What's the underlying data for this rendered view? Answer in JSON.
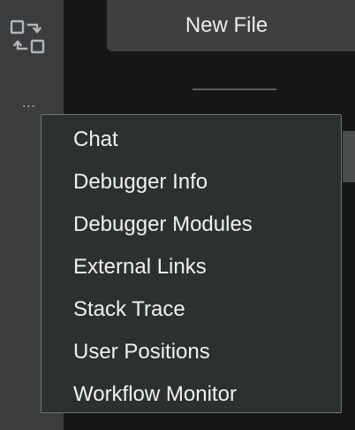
{
  "activity_bar": {
    "icons": [
      {
        "name": "swap-view-icon"
      },
      {
        "name": "more-options-icon",
        "glyph": "⋯"
      }
    ]
  },
  "editor": {
    "new_file_label": "New File"
  },
  "menu": {
    "items": [
      {
        "label": "Chat"
      },
      {
        "label": "Debugger Info"
      },
      {
        "label": "Debugger Modules"
      },
      {
        "label": "External Links"
      },
      {
        "label": "Stack Trace"
      },
      {
        "label": "User Positions"
      },
      {
        "label": "Workflow Monitor"
      }
    ]
  },
  "colors": {
    "activity_bar_bg": "#3a3c3d",
    "main_bg": "#171717",
    "button_bg": "#3d3f40",
    "menu_bg": "#2d3031",
    "menu_border": "#707273",
    "text": "#f1f1f1"
  }
}
